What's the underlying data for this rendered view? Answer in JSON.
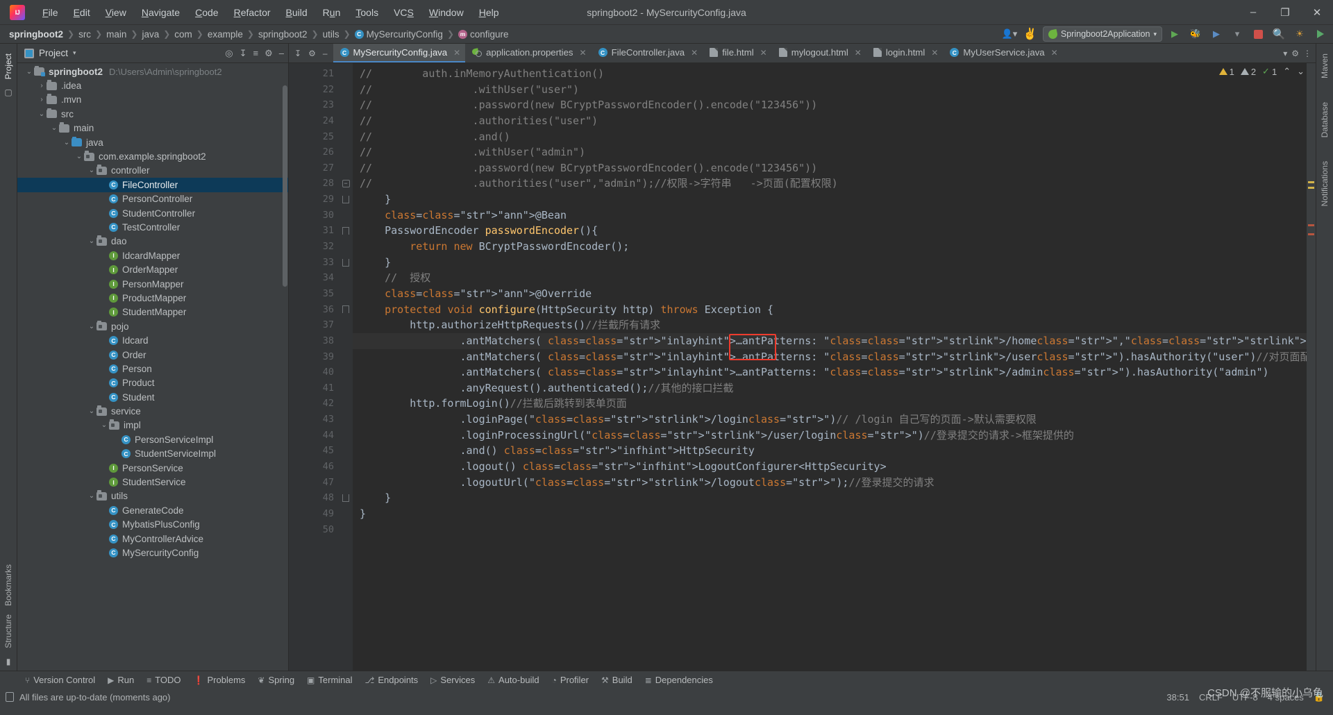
{
  "window": {
    "title": "springboot2 - MySercurityConfig.java",
    "minimize": "–",
    "maximize": "❐",
    "close": "✕"
  },
  "menubar": {
    "items": [
      "File",
      "Edit",
      "View",
      "Navigate",
      "Code",
      "Refactor",
      "Build",
      "Run",
      "Tools",
      "VCS",
      "Window",
      "Help"
    ]
  },
  "breadcrumb": {
    "items": [
      {
        "label": "springboot2",
        "icon": "",
        "bold": true
      },
      {
        "label": "src",
        "icon": ""
      },
      {
        "label": "main",
        "icon": ""
      },
      {
        "label": "java",
        "icon": ""
      },
      {
        "label": "com",
        "icon": ""
      },
      {
        "label": "example",
        "icon": ""
      },
      {
        "label": "springboot2",
        "icon": ""
      },
      {
        "label": "utils",
        "icon": ""
      },
      {
        "label": "MySercurityConfig",
        "icon": "class-icon",
        "glyph": "C"
      },
      {
        "label": "configure",
        "icon": "method-icon",
        "glyph": "m"
      }
    ],
    "separator": "❯"
  },
  "toolbar": {
    "account_icon": "account-icon",
    "hammer_icon": "build-hammer-icon",
    "run_config": "Springboot2Application",
    "run_config_caret": "▾",
    "add_config_icon": "add-config-icon",
    "debug_icon": "debug-bug-icon",
    "run_with_coverage_icon": "coverage-icon",
    "more_run_icon": "more-run-icon",
    "stop_label": "stop",
    "search_icon": "🔍",
    "updates_icon": "updates-icon",
    "run_icon": "run-icon"
  },
  "left_strip": {
    "tabs": [
      "Project"
    ],
    "bottom_tabs": [
      "Bookmarks",
      "Structure"
    ]
  },
  "right_strip": {
    "tabs": [
      "Maven",
      "Database",
      "Notifications"
    ]
  },
  "project_panel": {
    "title": "Project",
    "caret": "▾",
    "actions": [
      "target-icon",
      "collapse-all-icon",
      "sort-icon",
      "settings-gear-icon",
      "hide-icon"
    ],
    "tree": [
      {
        "depth": 0,
        "arrow": "down",
        "icon": "module-folder",
        "label": "springboot2",
        "bold": true,
        "path": "D:\\Users\\Admin\\springboot2"
      },
      {
        "depth": 1,
        "arrow": "right",
        "icon": "folder",
        "label": ".idea"
      },
      {
        "depth": 1,
        "arrow": "right",
        "icon": "folder",
        "label": ".mvn"
      },
      {
        "depth": 1,
        "arrow": "down",
        "icon": "folder",
        "label": "src"
      },
      {
        "depth": 2,
        "arrow": "down",
        "icon": "folder",
        "label": "main"
      },
      {
        "depth": 3,
        "arrow": "down",
        "icon": "source-folder",
        "label": "java"
      },
      {
        "depth": 4,
        "arrow": "down",
        "icon": "package",
        "label": "com.example.springboot2"
      },
      {
        "depth": 5,
        "arrow": "down",
        "icon": "package",
        "label": "controller"
      },
      {
        "depth": 6,
        "arrow": "none",
        "icon": "class",
        "label": "FileController",
        "selected": true
      },
      {
        "depth": 6,
        "arrow": "none",
        "icon": "class",
        "label": "PersonController"
      },
      {
        "depth": 6,
        "arrow": "none",
        "icon": "class",
        "label": "StudentController"
      },
      {
        "depth": 6,
        "arrow": "none",
        "icon": "class",
        "label": "TestController"
      },
      {
        "depth": 5,
        "arrow": "down",
        "icon": "package",
        "label": "dao"
      },
      {
        "depth": 6,
        "arrow": "none",
        "icon": "interface",
        "label": "IdcardMapper"
      },
      {
        "depth": 6,
        "arrow": "none",
        "icon": "interface",
        "label": "OrderMapper"
      },
      {
        "depth": 6,
        "arrow": "none",
        "icon": "interface",
        "label": "PersonMapper"
      },
      {
        "depth": 6,
        "arrow": "none",
        "icon": "interface",
        "label": "ProductMapper"
      },
      {
        "depth": 6,
        "arrow": "none",
        "icon": "interface",
        "label": "StudentMapper"
      },
      {
        "depth": 5,
        "arrow": "down",
        "icon": "package",
        "label": "pojo"
      },
      {
        "depth": 6,
        "arrow": "none",
        "icon": "class",
        "label": "Idcard"
      },
      {
        "depth": 6,
        "arrow": "none",
        "icon": "class",
        "label": "Order"
      },
      {
        "depth": 6,
        "arrow": "none",
        "icon": "class",
        "label": "Person"
      },
      {
        "depth": 6,
        "arrow": "none",
        "icon": "class",
        "label": "Product"
      },
      {
        "depth": 6,
        "arrow": "none",
        "icon": "class",
        "label": "Student"
      },
      {
        "depth": 5,
        "arrow": "down",
        "icon": "package",
        "label": "service"
      },
      {
        "depth": 6,
        "arrow": "down",
        "icon": "package",
        "label": "impl"
      },
      {
        "depth": 7,
        "arrow": "none",
        "icon": "class",
        "label": "PersonServiceImpl"
      },
      {
        "depth": 7,
        "arrow": "none",
        "icon": "class",
        "label": "StudentServiceImpl"
      },
      {
        "depth": 6,
        "arrow": "none",
        "icon": "interface",
        "label": "PersonService"
      },
      {
        "depth": 6,
        "arrow": "none",
        "icon": "interface",
        "label": "StudentService"
      },
      {
        "depth": 5,
        "arrow": "down",
        "icon": "package",
        "label": "utils"
      },
      {
        "depth": 6,
        "arrow": "none",
        "icon": "class",
        "label": "GenerateCode"
      },
      {
        "depth": 6,
        "arrow": "none",
        "icon": "class",
        "label": "MybatisPlusConfig"
      },
      {
        "depth": 6,
        "arrow": "none",
        "icon": "class",
        "label": "MyControllerAdvice"
      },
      {
        "depth": 6,
        "arrow": "none",
        "icon": "class",
        "label": "MySercurityConfig"
      }
    ]
  },
  "editor": {
    "tabs": [
      {
        "label": "MySercurityConfig.java",
        "icon": "class-icon",
        "active": true,
        "close": "✕"
      },
      {
        "label": "application.properties",
        "icon": "spring-properties-icon",
        "close": "✕"
      },
      {
        "label": "FileController.java",
        "icon": "class-icon",
        "close": "✕"
      },
      {
        "label": "file.html",
        "icon": "html-icon",
        "close": "✕"
      },
      {
        "label": "mylogout.html",
        "icon": "html-icon",
        "close": "✕"
      },
      {
        "label": "login.html",
        "icon": "html-icon",
        "close": "✕"
      },
      {
        "label": "MyUserService.java",
        "icon": "class-icon",
        "close": "✕"
      }
    ],
    "tab_actions": [
      "recent-files-icon",
      "settings-gear-icon",
      "hide-editor-icon"
    ],
    "inspections": {
      "warnings": "1",
      "weak_warnings": "2",
      "typos": "1",
      "chevron_up": "⌃",
      "chevron_down": "⌄"
    },
    "first_line_number": 21,
    "lines": [
      {
        "n": 21,
        "text": "//        auth.inMemoryAuthentication()"
      },
      {
        "n": 22,
        "text": "//                .withUser(\"user\")"
      },
      {
        "n": 23,
        "text": "//                .password(new BCryptPasswordEncoder().encode(\"123456\"))"
      },
      {
        "n": 24,
        "text": "//                .authorities(\"user\")"
      },
      {
        "n": 25,
        "text": "//                .and()"
      },
      {
        "n": 26,
        "text": "//                .withUser(\"admin\")"
      },
      {
        "n": 27,
        "text": "//                .password(new BCryptPasswordEncoder().encode(\"123456\"))"
      },
      {
        "n": 28,
        "text": "//                .authorities(\"user\",\"admin\");//权限->字符串   ->页面(配置权限)"
      },
      {
        "n": 29,
        "text": "    }"
      },
      {
        "n": 30,
        "text": "    @Bean"
      },
      {
        "n": 31,
        "text": "    PasswordEncoder passwordEncoder(){"
      },
      {
        "n": 32,
        "text": "        return new BCryptPasswordEncoder();"
      },
      {
        "n": 33,
        "text": "    }"
      },
      {
        "n": 34,
        "text": "    //  授权"
      },
      {
        "n": 35,
        "text": "    @Override"
      },
      {
        "n": 36,
        "text": "    protected void configure(HttpSecurity http) throws Exception {"
      },
      {
        "n": 37,
        "text": "        http.authorizeHttpRequests()//拦截所有请求"
      },
      {
        "n": 38,
        "text": "                .antMatchers( ...antPatterns: \"/home\",\"/login\",\"/**\").permitAll()//某些请求不需要登录->放行某些接口"
      },
      {
        "n": 39,
        "text": "                .antMatchers( ...antPatterns: \"/user\").hasAuthority(\"user\")//对页面配置权限"
      },
      {
        "n": 40,
        "text": "                .antMatchers( ...antPatterns: \"/admin\").hasAuthority(\"admin\")"
      },
      {
        "n": 41,
        "text": "                .anyRequest().authenticated();//其他的接口拦截"
      },
      {
        "n": 42,
        "text": "        http.formLogin()//拦截后跳转到表单页面"
      },
      {
        "n": 43,
        "text": "                .loginPage(\"/login\")// /login 自己写的页面->默认需要权限"
      },
      {
        "n": 44,
        "text": "                .loginProcessingUrl(\"/user/login\")//登录提交的请求->框架提供的"
      },
      {
        "n": 45,
        "text": "                .and() HttpSecurity"
      },
      {
        "n": 46,
        "text": "                .logout() LogoutConfigurer<HttpSecurity>"
      },
      {
        "n": 47,
        "text": "                .logoutUrl(\"/logout\");//登录提交的请求"
      },
      {
        "n": 48,
        "text": "    }"
      },
      {
        "n": 49,
        "text": "}"
      },
      {
        "n": 50,
        "text": ""
      }
    ],
    "inlay_antpatterns": "...antPatterns:",
    "inlay_httpsecurity": "HttpSecurity",
    "inlay_logoutconfigurer": "LogoutConfigurer<HttpSecurity>"
  },
  "bottom_tools": {
    "items": [
      {
        "label": "Version Control",
        "icon": "branch-icon"
      },
      {
        "label": "Run",
        "icon": "run-icon"
      },
      {
        "label": "TODO",
        "icon": "todo-icon"
      },
      {
        "label": "Problems",
        "icon": "problems-icon"
      },
      {
        "label": "Spring",
        "icon": "spring-leaf-icon"
      },
      {
        "label": "Terminal",
        "icon": "terminal-icon"
      },
      {
        "label": "Endpoints",
        "icon": "endpoints-icon"
      },
      {
        "label": "Services",
        "icon": "services-icon"
      },
      {
        "label": "Auto-build",
        "icon": "auto-build-icon"
      },
      {
        "label": "Profiler",
        "icon": "profiler-icon"
      },
      {
        "label": "Build",
        "icon": "build-hammer-icon"
      },
      {
        "label": "Dependencies",
        "icon": "dependencies-icon"
      }
    ]
  },
  "statusbar": {
    "message": "All files are up-to-date (moments ago)",
    "caret_position": "38:51",
    "line_separator": "CRLF",
    "encoding": "UTF-8",
    "indent": "4 spaces",
    "branch": "",
    "lock_icon": "lock-icon"
  },
  "watermark": "CSDN @不服输的小乌龟",
  "colors": {
    "accent": "#4a88c7",
    "selection": "#0d3a58",
    "editor_bg": "#2b2b2b",
    "panel_bg": "#3c3f41",
    "redbox": "#ef3b2d",
    "string": "#6a8759",
    "keyword": "#cc7832",
    "annotation": "#bbb529",
    "comment": "#808080"
  }
}
